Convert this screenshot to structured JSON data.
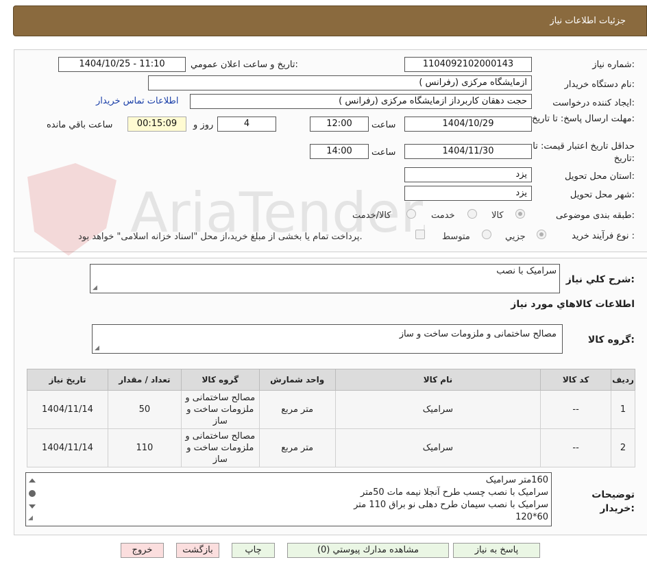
{
  "header": {
    "title": "جزئیات اطلاعات نیاز"
  },
  "fields": {
    "need_number_label": "شماره نیاز:",
    "need_number": "1104092102000143",
    "announce_label": "تاریخ و ساعت اعلان عمومي:",
    "announce_value": "1404/10/25 - 11:10",
    "buyer_org_label": "نام دستگاه خريدار:",
    "buyer_org": "ازمايشگاه مرکزی (رفرانس )",
    "requester_label": "ايجاد كننده درخواست:",
    "requester": "حجت دهقان کاربرداز ازمايشگاه مرکزی (رفرانس )",
    "contact_link": "اطلاعات تماس خريدار",
    "deadline_label": "مهلت ارسال پاسخ: تا تاريخ:",
    "deadline_date": "1404/10/29",
    "time_label": "ساعت",
    "deadline_time": "12:00",
    "days": "4",
    "days_label": "روز و",
    "remaining_time": "00:15:09",
    "remaining_label": "ساعت باقي مانده",
    "validity_label": "حداقل تاريخ اعتبار قيمت: تا تاريخ:",
    "validity_date": "1404/11/30",
    "validity_time": "14:00",
    "province_label": "استان محل تحويل:",
    "province": "یزد",
    "city_label": "شهر محل تحويل:",
    "city": "یزد",
    "category_label": "طبقه بندی موضوعی:",
    "category_options": [
      "كالا",
      "خدمت",
      "كالا/خدمت"
    ],
    "process_label": "نوع فرآيند خريد :",
    "process_options": [
      "جزيي",
      "متوسط"
    ],
    "payment_note": "پرداخت تمام يا بخشی از مبلغ خريد،از محل \"اسناد خزانه اسلامی\" خواهد بود."
  },
  "watermark": {
    "text": "AriaTender.net"
  },
  "description": {
    "label": "شرح كلي نياز:",
    "value": "سرامیک با نصب"
  },
  "goods_info": {
    "title": "اطلاعات كالاهاي مورد نياز",
    "group_label": "گروه كالا:",
    "group_value": "مصالح ساختمانی و ملزومات ساخت و ساز"
  },
  "table": {
    "headers": [
      "رديف",
      "كد كالا",
      "نام كالا",
      "واحد شمارش",
      "گروه كالا",
      "تعداد / مقدار",
      "تاريخ نياز"
    ],
    "rows": [
      {
        "row": "1",
        "code": "--",
        "name": "سرامیک",
        "unit": "متر مربع",
        "group": "مصالح ساختمانی و ملزومات ساخت و ساز",
        "qty": "50",
        "date": "1404/11/14"
      },
      {
        "row": "2",
        "code": "--",
        "name": "سرامیک",
        "unit": "متر مربع",
        "group": "مصالح ساختمانی و ملزومات ساخت و ساز",
        "qty": "110",
        "date": "1404/11/14"
      }
    ]
  },
  "buyer_notes": {
    "label": "توضيحات خريدار:",
    "lines": [
      "160متر سرامیک",
      "سرامیک با نصب چسب طرح آنجلا نیمه مات 50متر",
      "سرامیک با نصب سیمان طرح دهلی نو براق 110 متر",
      "60*120"
    ]
  },
  "buttons": {
    "reply": "پاسخ به نياز",
    "attachments": "مشاهده مدارك پيوستي (0)",
    "print": "چاپ",
    "back": "بازگشت",
    "exit": "خروج"
  },
  "colors": {
    "header_bg": "#8a6a3e",
    "button_green": "#eaf6e4",
    "button_pink": "#fbdede",
    "link": "#1a3fa8"
  }
}
